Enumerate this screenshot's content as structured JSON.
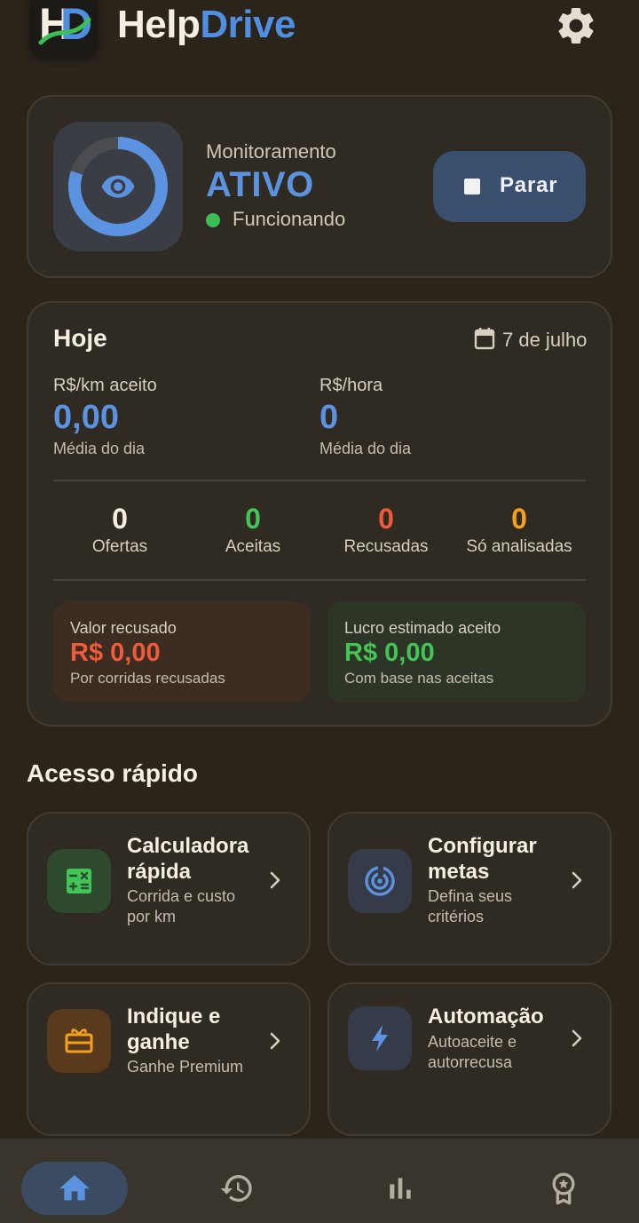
{
  "header": {
    "brand_part1": "Help",
    "brand_part2": "Drive",
    "icons": {
      "logo": "helpdrive-logo",
      "settings": "gear-icon"
    }
  },
  "monitor": {
    "label": "Monitoramento",
    "status": "ATIVO",
    "substatus": "Funcionando",
    "button_label": "Parar",
    "progress": 0.8
  },
  "today": {
    "title": "Hoje",
    "date": "7 de julho",
    "kpis": [
      {
        "label": "R$/km aceito",
        "value": "0,00",
        "sub": "Média do dia"
      },
      {
        "label": "R$/hora",
        "value": "0",
        "sub": "Média do dia"
      }
    ],
    "stats": [
      {
        "value": "0",
        "label": "Ofertas",
        "color": "#f4eee3"
      },
      {
        "value": "0",
        "label": "Aceitas",
        "color": "#43c457"
      },
      {
        "value": "0",
        "label": "Recusadas",
        "color": "#ef5a3a"
      },
      {
        "value": "0",
        "label": "Só analisadas",
        "color": "#f3a01c"
      }
    ],
    "refused": {
      "label": "Valor recusado",
      "value": "R$ 0,00",
      "sub": "Por corridas recusadas",
      "color": "#ef5a3a"
    },
    "profit": {
      "label": "Lucro estimado aceito",
      "value": "R$ 0,00",
      "sub": "Com base nas aceitas",
      "color": "#43c457"
    }
  },
  "quick_access": {
    "title": "Acesso rápido",
    "tiles": [
      {
        "title1": "Calculadora",
        "title2": "rápida",
        "sub1": "Corrida e custo",
        "sub2": "por km",
        "icon": "calculator-icon"
      },
      {
        "title1": "Configurar",
        "title2": "metas",
        "sub1": "Defina seus",
        "sub2": "critérios",
        "icon": "target-icon"
      },
      {
        "title1": "Indique e",
        "title2": "ganhe",
        "sub1": "Ganhe Premium",
        "sub2": "",
        "icon": "gift-icon"
      },
      {
        "title1": "Automação",
        "title2": "",
        "sub1": "Autoaceite e",
        "sub2": "autorrecusa",
        "icon": "bolt-icon"
      }
    ]
  },
  "nav": {
    "items": [
      "home-icon",
      "history-icon",
      "bar-chart-icon",
      "award-icon"
    ],
    "active": "home-icon"
  },
  "colors": {
    "accent": "#5b93e0",
    "background": "#2a241b",
    "card": "#2f2a22"
  }
}
